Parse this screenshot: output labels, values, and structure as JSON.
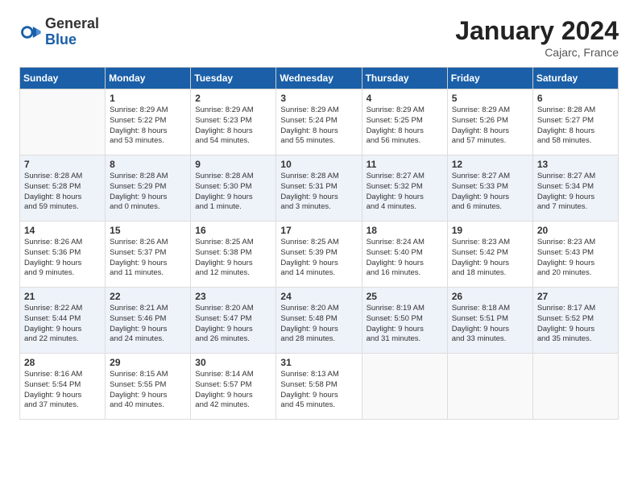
{
  "logo": {
    "general": "General",
    "blue": "Blue"
  },
  "title": "January 2024",
  "location": "Cajarc, France",
  "days_of_week": [
    "Sunday",
    "Monday",
    "Tuesday",
    "Wednesday",
    "Thursday",
    "Friday",
    "Saturday"
  ],
  "weeks": [
    [
      {
        "day": "",
        "info": ""
      },
      {
        "day": "1",
        "info": "Sunrise: 8:29 AM\nSunset: 5:22 PM\nDaylight: 8 hours\nand 53 minutes."
      },
      {
        "day": "2",
        "info": "Sunrise: 8:29 AM\nSunset: 5:23 PM\nDaylight: 8 hours\nand 54 minutes."
      },
      {
        "day": "3",
        "info": "Sunrise: 8:29 AM\nSunset: 5:24 PM\nDaylight: 8 hours\nand 55 minutes."
      },
      {
        "day": "4",
        "info": "Sunrise: 8:29 AM\nSunset: 5:25 PM\nDaylight: 8 hours\nand 56 minutes."
      },
      {
        "day": "5",
        "info": "Sunrise: 8:29 AM\nSunset: 5:26 PM\nDaylight: 8 hours\nand 57 minutes."
      },
      {
        "day": "6",
        "info": "Sunrise: 8:28 AM\nSunset: 5:27 PM\nDaylight: 8 hours\nand 58 minutes."
      }
    ],
    [
      {
        "day": "7",
        "info": "Sunrise: 8:28 AM\nSunset: 5:28 PM\nDaylight: 8 hours\nand 59 minutes."
      },
      {
        "day": "8",
        "info": "Sunrise: 8:28 AM\nSunset: 5:29 PM\nDaylight: 9 hours\nand 0 minutes."
      },
      {
        "day": "9",
        "info": "Sunrise: 8:28 AM\nSunset: 5:30 PM\nDaylight: 9 hours\nand 1 minute."
      },
      {
        "day": "10",
        "info": "Sunrise: 8:28 AM\nSunset: 5:31 PM\nDaylight: 9 hours\nand 3 minutes."
      },
      {
        "day": "11",
        "info": "Sunrise: 8:27 AM\nSunset: 5:32 PM\nDaylight: 9 hours\nand 4 minutes."
      },
      {
        "day": "12",
        "info": "Sunrise: 8:27 AM\nSunset: 5:33 PM\nDaylight: 9 hours\nand 6 minutes."
      },
      {
        "day": "13",
        "info": "Sunrise: 8:27 AM\nSunset: 5:34 PM\nDaylight: 9 hours\nand 7 minutes."
      }
    ],
    [
      {
        "day": "14",
        "info": "Sunrise: 8:26 AM\nSunset: 5:36 PM\nDaylight: 9 hours\nand 9 minutes."
      },
      {
        "day": "15",
        "info": "Sunrise: 8:26 AM\nSunset: 5:37 PM\nDaylight: 9 hours\nand 11 minutes."
      },
      {
        "day": "16",
        "info": "Sunrise: 8:25 AM\nSunset: 5:38 PM\nDaylight: 9 hours\nand 12 minutes."
      },
      {
        "day": "17",
        "info": "Sunrise: 8:25 AM\nSunset: 5:39 PM\nDaylight: 9 hours\nand 14 minutes."
      },
      {
        "day": "18",
        "info": "Sunrise: 8:24 AM\nSunset: 5:40 PM\nDaylight: 9 hours\nand 16 minutes."
      },
      {
        "day": "19",
        "info": "Sunrise: 8:23 AM\nSunset: 5:42 PM\nDaylight: 9 hours\nand 18 minutes."
      },
      {
        "day": "20",
        "info": "Sunrise: 8:23 AM\nSunset: 5:43 PM\nDaylight: 9 hours\nand 20 minutes."
      }
    ],
    [
      {
        "day": "21",
        "info": "Sunrise: 8:22 AM\nSunset: 5:44 PM\nDaylight: 9 hours\nand 22 minutes."
      },
      {
        "day": "22",
        "info": "Sunrise: 8:21 AM\nSunset: 5:46 PM\nDaylight: 9 hours\nand 24 minutes."
      },
      {
        "day": "23",
        "info": "Sunrise: 8:20 AM\nSunset: 5:47 PM\nDaylight: 9 hours\nand 26 minutes."
      },
      {
        "day": "24",
        "info": "Sunrise: 8:20 AM\nSunset: 5:48 PM\nDaylight: 9 hours\nand 28 minutes."
      },
      {
        "day": "25",
        "info": "Sunrise: 8:19 AM\nSunset: 5:50 PM\nDaylight: 9 hours\nand 31 minutes."
      },
      {
        "day": "26",
        "info": "Sunrise: 8:18 AM\nSunset: 5:51 PM\nDaylight: 9 hours\nand 33 minutes."
      },
      {
        "day": "27",
        "info": "Sunrise: 8:17 AM\nSunset: 5:52 PM\nDaylight: 9 hours\nand 35 minutes."
      }
    ],
    [
      {
        "day": "28",
        "info": "Sunrise: 8:16 AM\nSunset: 5:54 PM\nDaylight: 9 hours\nand 37 minutes."
      },
      {
        "day": "29",
        "info": "Sunrise: 8:15 AM\nSunset: 5:55 PM\nDaylight: 9 hours\nand 40 minutes."
      },
      {
        "day": "30",
        "info": "Sunrise: 8:14 AM\nSunset: 5:57 PM\nDaylight: 9 hours\nand 42 minutes."
      },
      {
        "day": "31",
        "info": "Sunrise: 8:13 AM\nSunset: 5:58 PM\nDaylight: 9 hours\nand 45 minutes."
      },
      {
        "day": "",
        "info": ""
      },
      {
        "day": "",
        "info": ""
      },
      {
        "day": "",
        "info": ""
      }
    ]
  ]
}
